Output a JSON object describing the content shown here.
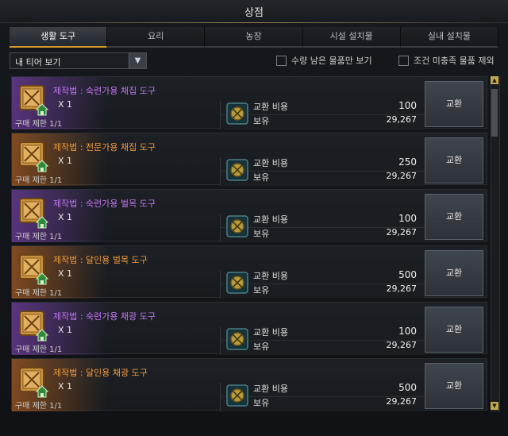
{
  "window": {
    "title": "상점"
  },
  "tabs": [
    {
      "label": "생활 도구",
      "active": true
    },
    {
      "label": "요리"
    },
    {
      "label": "농장"
    },
    {
      "label": "시설 설치물"
    },
    {
      "label": "실내 설치물"
    }
  ],
  "filter": {
    "selected": "내 티어 보기",
    "options_icon": "chevron-down-icon"
  },
  "checkboxes": [
    {
      "label": "수량 남은 물품만 보기",
      "checked": false
    },
    {
      "label": "조건 미충족 물품 제외",
      "checked": false
    }
  ],
  "labels": {
    "cost": "교환 비용",
    "owned": "보유",
    "exchange_button": "교환"
  },
  "colors": {
    "purple_item": "#c277f2",
    "orange_item": "#f39a3a",
    "active_tab_underline": "#d39b2c"
  },
  "items": [
    {
      "name": "제작법 : 숙련가용 채집 도구",
      "qty": "X 1",
      "limit": "구매 제한 1/1",
      "cost": "100",
      "owned": "29,267",
      "rarity": "purple"
    },
    {
      "name": "제작법 : 전문가용 채집 도구",
      "qty": "X 1",
      "limit": "구매 제한 1/1",
      "cost": "250",
      "owned": "29,267",
      "rarity": "orange"
    },
    {
      "name": "제작법 : 숙련가용 벌목 도구",
      "qty": "X 1",
      "limit": "구매 제한 1/1",
      "cost": "100",
      "owned": "29,267",
      "rarity": "purple"
    },
    {
      "name": "제작법 : 달인용 벌목 도구",
      "qty": "X 1",
      "limit": "구매 제한 1/1",
      "cost": "500",
      "owned": "29,267",
      "rarity": "orange"
    },
    {
      "name": "제작법 : 숙련가용 채광 도구",
      "qty": "X 1",
      "limit": "구매 제한 1/1",
      "cost": "100",
      "owned": "29,267",
      "rarity": "purple"
    },
    {
      "name": "제작법 : 달인용 채광 도구",
      "qty": "X 1",
      "limit": "구매 제한 1/1",
      "cost": "500",
      "owned": "29,267",
      "rarity": "orange"
    }
  ]
}
